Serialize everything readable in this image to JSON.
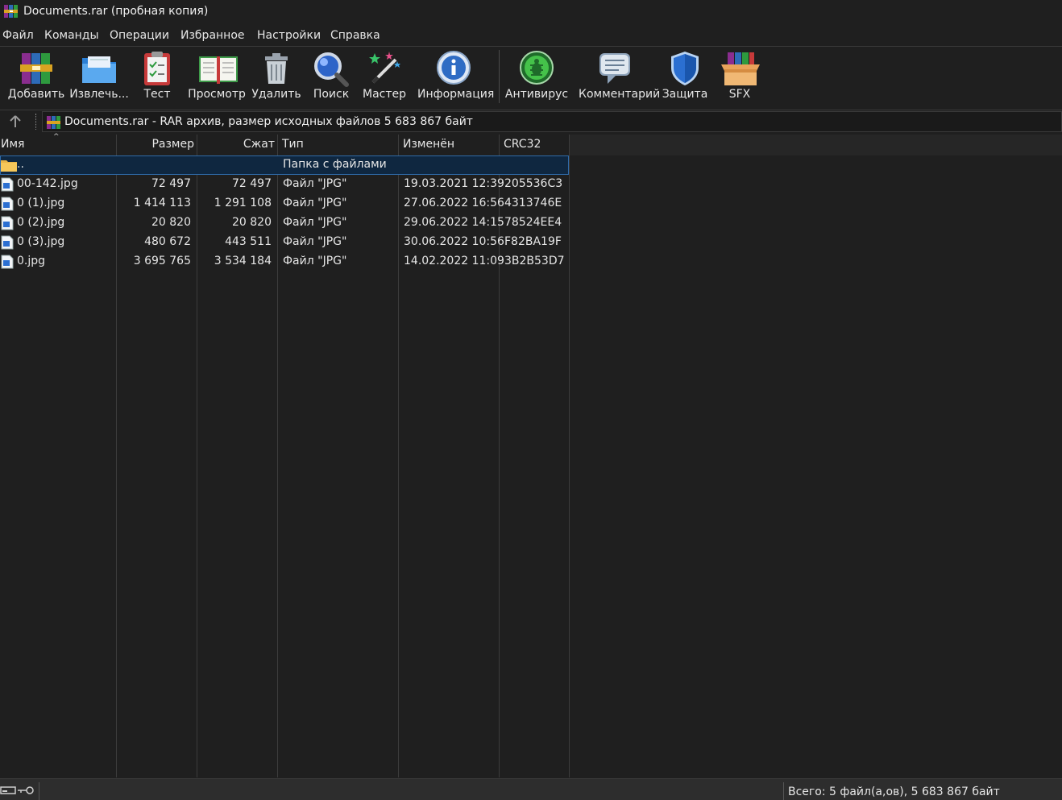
{
  "window": {
    "title": "Documents.rar (пробная копия)"
  },
  "menu": [
    "Файл",
    "Команды",
    "Операции",
    "Избранное",
    "Настройки",
    "Справка"
  ],
  "toolbar": [
    {
      "label": "Добавить",
      "icon": "add-archive-icon"
    },
    {
      "label": "Извлечь...",
      "icon": "extract-folder-icon"
    },
    {
      "label": "Тест",
      "icon": "test-clipboard-icon"
    },
    {
      "label": "Просмотр",
      "icon": "view-book-icon"
    },
    {
      "label": "Удалить",
      "icon": "trash-icon"
    },
    {
      "label": "Поиск",
      "icon": "magnifier-icon"
    },
    {
      "label": "Мастер",
      "icon": "wizard-wand-icon"
    },
    {
      "label": "Информация",
      "icon": "info-icon"
    },
    {
      "label": "Антивирус",
      "icon": "antivirus-bug-icon"
    },
    {
      "label": "Комментарий",
      "icon": "comment-icon"
    },
    {
      "label": "Защита",
      "icon": "shield-icon"
    },
    {
      "label": "SFX",
      "icon": "sfx-box-icon"
    }
  ],
  "address": {
    "text": "Documents.rar - RAR архив, размер исходных файлов 5 683 867 байт"
  },
  "columns": [
    "Имя",
    "Размер",
    "Сжат",
    "Тип",
    "Изменён",
    "CRC32"
  ],
  "parent_row": {
    "name": "..",
    "type": "Папка с файлами"
  },
  "files": [
    {
      "name": "00-142.jpg",
      "size": "72 497",
      "packed": "72 497",
      "type": "Файл \"JPG\"",
      "modified": "19.03.2021 12:39",
      "crc": "205536C3"
    },
    {
      "name": "0 (1).jpg",
      "size": "1 414 113",
      "packed": "1 291 108",
      "type": "Файл \"JPG\"",
      "modified": "27.06.2022 16:56",
      "crc": "4313746E"
    },
    {
      "name": "0 (2).jpg",
      "size": "20 820",
      "packed": "20 820",
      "type": "Файл \"JPG\"",
      "modified": "29.06.2022 14:15",
      "crc": "78524EE4"
    },
    {
      "name": "0 (3).jpg",
      "size": "480 672",
      "packed": "443 511",
      "type": "Файл \"JPG\"",
      "modified": "30.06.2022 10:56",
      "crc": "F82BA19F"
    },
    {
      "name": "0.jpg",
      "size": "3 695 765",
      "packed": "3 534 184",
      "type": "Файл \"JPG\"",
      "modified": "14.02.2022 11:09",
      "crc": "3B2B53D7"
    }
  ],
  "status": {
    "text": "Всего: 5 файл(а,ов), 5 683 867 байт"
  }
}
